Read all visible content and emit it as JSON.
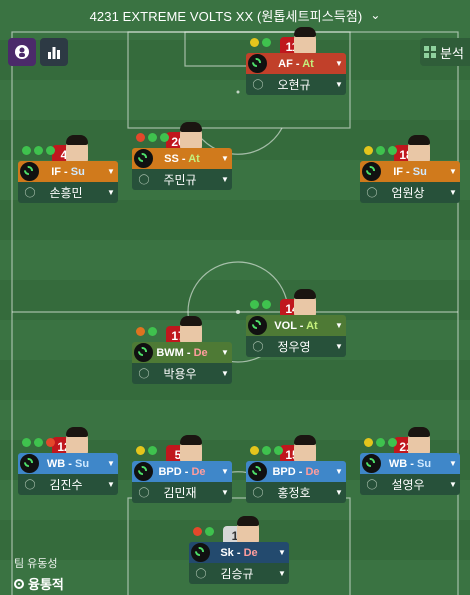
{
  "header": {
    "title": "4231 EXTREME VOLTS  XX (원톱세트피스득점)",
    "dropdown_icon": "chevron-down-icon"
  },
  "toolbar": {
    "left_buttons": [
      "player-info-icon",
      "bar-chart-icon"
    ],
    "analysis_label": "분석"
  },
  "players": {
    "st": {
      "number": "11",
      "role": "AF",
      "duty": "At",
      "name": "오현규",
      "dots": [
        "y",
        "g"
      ]
    },
    "aml": {
      "number": "4",
      "role": "IF",
      "duty": "Su",
      "name": "손흥민",
      "dots": [
        "g",
        "g",
        "g"
      ]
    },
    "amc": {
      "number": "20",
      "role": "SS",
      "duty": "At",
      "name": "주민규",
      "dots": [
        "r",
        "g",
        "g"
      ]
    },
    "amr": {
      "number": "18",
      "role": "IF",
      "duty": "Su",
      "name": "엄원상",
      "dots": [
        "y",
        "g",
        "g"
      ]
    },
    "dmr": {
      "number": "14",
      "role": "VOL",
      "duty": "At",
      "name": "정우영",
      "dots": [
        "g",
        "g"
      ]
    },
    "dml": {
      "number": "17",
      "role": "BWM",
      "duty": "De",
      "name": "박용우",
      "dots": [
        "o",
        "g"
      ]
    },
    "dl": {
      "number": "12",
      "role": "WB",
      "duty": "Su",
      "name": "김진수",
      "dots": [
        "g",
        "g",
        "r"
      ]
    },
    "dcl": {
      "number": "5",
      "role": "BPD",
      "duty": "De",
      "name": "김민재",
      "dots": [
        "y",
        "g"
      ]
    },
    "dcr": {
      "number": "15",
      "role": "BPD",
      "duty": "De",
      "name": "홍정호",
      "dots": [
        "y",
        "g",
        "g"
      ]
    },
    "dr": {
      "number": "21",
      "role": "WB",
      "duty": "Su",
      "name": "설영우",
      "dots": [
        "y",
        "g",
        "g"
      ]
    },
    "gk": {
      "number": "1",
      "role": "Sk",
      "duty": "De",
      "name": "김승규",
      "dots": [
        "r",
        "g"
      ]
    }
  },
  "fluidity": {
    "label": "팀 유동성",
    "value": "융통적"
  },
  "colors": {
    "pitch": "#3a7342",
    "af": "#c1402a",
    "attack_mid": "#d07a1c",
    "volante": "#4e7a35",
    "defender": "#3f87c9",
    "goalkeeper": "#234a6e"
  }
}
